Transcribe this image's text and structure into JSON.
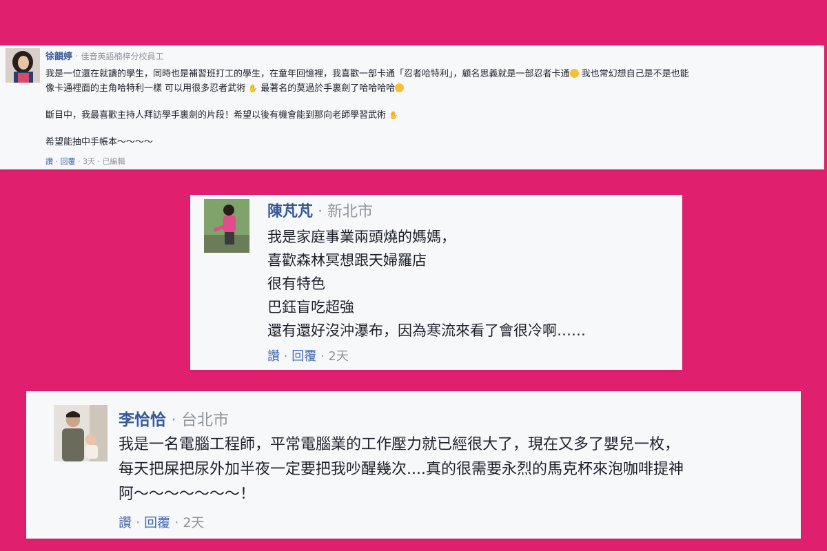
{
  "comments": [
    {
      "name": "徐韻婷",
      "location": "佳音英語楠梓分校員工",
      "lines": [
        "我是一位還在就讀的學生，同時也是補習班打工的學生，在童年回憶裡，我喜歡一部卡通「忍者哈特利」，顧名思義就是一部忍者卡通",
        "像卡通裡面的主角哈特利一樣 可以用很多忍者武術",
        "斷目中，我最喜歡主持人拜訪學手裏劍的片段！希望以後有機會能到那向老師學習武術",
        "希望能抽中手帳本～～～～"
      ],
      "line1_tail": "我也常幻想自己是不是也能",
      "line2_tail": "最著名的莫過於手裏劍了哈哈哈哈",
      "like": "讚",
      "reply": "回覆",
      "time": "3天",
      "edited": "已編輯"
    },
    {
      "name": "陳芃芃",
      "location": "新北市",
      "lines": [
        "我是家庭事業兩頭燒的媽媽，",
        "喜歡森林冥想跟天婦羅店",
        "很有特色",
        "巴鈺盲吃超強",
        "還有還好沒沖瀑布，因為寒流來看了會很冷啊……"
      ],
      "like": "讚",
      "reply": "回覆",
      "time": "2天"
    },
    {
      "name": "李恰恰",
      "location": "台北市",
      "lines": [
        "我是一名電腦工程師，平常電腦業的工作壓力就已經很大了，現在又多了嬰兒一枚，",
        "每天把屎把尿外加半夜一定要把我吵醒幾次....真的很需要永烈的馬克杯來泡咖啡提神",
        "阿～～～～～～～！"
      ],
      "like": "讚",
      "reply": "回覆",
      "time": "2天"
    }
  ],
  "separator": "·",
  "colors": {
    "background": "#e0206e",
    "card": "#f7f8fa",
    "name": "#365899",
    "action": "#4267b2",
    "meta": "#90949c"
  },
  "icons": [
    "tongue-out-emoji-icon",
    "praying-hands-icon",
    "laughing-tears-emoji-icon"
  ]
}
